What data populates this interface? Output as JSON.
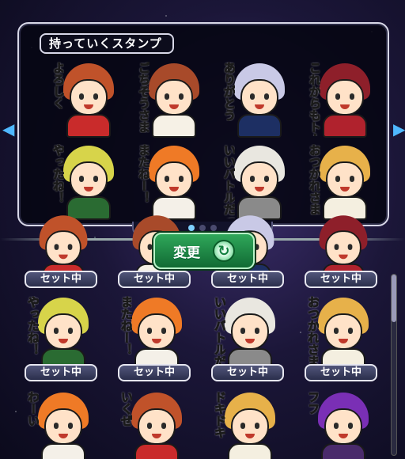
{
  "panel": {
    "title": "持っていくスタンプ",
    "page_count": 3,
    "current_page": 1
  },
  "change_button": {
    "label": "変更"
  },
  "set_label": "セット中",
  "stickers_carried": [
    {
      "text": "よろしく",
      "hair": "#c0522a",
      "outfit": "#c92b2b",
      "text_color": "#3fd35a"
    },
    {
      "text": "ごちそうさま",
      "hair": "#a84a2a",
      "outfit": "#f6f1e6",
      "text_color": "#ff6aa0"
    },
    {
      "text": "ありがとう",
      "hair": "#c9c9e6",
      "outfit": "#1d2f63",
      "text_color": "#ff6aa0"
    },
    {
      "text": "これからもトーゼンね",
      "hair": "#8e1f2a",
      "outfit": "#b0222d",
      "text_color": "#ffcf3a"
    },
    {
      "text": "やったね！",
      "hair": "#d7d44a",
      "outfit": "#2a6b32",
      "text_color": "#3fd35a"
    },
    {
      "text": "またねー！",
      "hair": "#ef7a26",
      "outfit": "#f4f0e8",
      "text_color": "#3fd35a"
    },
    {
      "text": "いいバトルだった！",
      "hair": "#e9e7e0",
      "outfit": "#8a8a8a",
      "text_color": "#ffcf3a"
    },
    {
      "text": "おつかれさま",
      "hair": "#e7b14a",
      "outfit": "#f4efe0",
      "text_color": "#ff6aa0"
    }
  ],
  "collection": [
    {
      "hair": "#c0522a",
      "outfit": "#c92b2b",
      "set": true
    },
    {
      "hair": "#a84a2a",
      "outfit": "#f6f1e6",
      "set": true
    },
    {
      "hair": "#c9c9e6",
      "outfit": "#1d2f63",
      "set": true
    },
    {
      "hair": "#8e1f2a",
      "outfit": "#b0222d",
      "set": true
    },
    {
      "text": "やったね！",
      "hair": "#d7d44a",
      "outfit": "#2a6b32",
      "text_color": "#3fd35a",
      "set": true
    },
    {
      "text": "またねー！",
      "hair": "#ef7a26",
      "outfit": "#f4f0e8",
      "text_color": "#3fd35a",
      "set": true
    },
    {
      "text": "いいバトルだった！",
      "hair": "#e9e7e0",
      "outfit": "#8a8a8a",
      "text_color": "#ffcf3a",
      "set": true
    },
    {
      "text": "おつかれさま",
      "hair": "#e7b14a",
      "outfit": "#f4efe0",
      "text_color": "#ff6aa0",
      "set": true
    },
    {
      "text": "わーい",
      "hair": "#ef7a26",
      "outfit": "#f4f0e8",
      "text_color": "#ff6aa0",
      "set": false
    },
    {
      "text": "いくぜ",
      "hair": "#c0522a",
      "outfit": "#c92b2b",
      "text_color": "#3fd35a",
      "set": false
    },
    {
      "text": "ドキドキ",
      "hair": "#e7b14a",
      "outfit": "#f4efe0",
      "text_color": "#ffcf3a",
      "set": false
    },
    {
      "text": "フフ",
      "hair": "#7a2fb5",
      "outfit": "#4a2b6b",
      "text_color": "#ff6aa0",
      "set": false
    }
  ],
  "colors": {
    "accent": "#4fb8ff",
    "button_green": "#2fa75a",
    "panel_border": "#d8d8e8"
  },
  "icons": {
    "prev": "chevron-left-icon",
    "next": "chevron-right-icon",
    "change": "refresh-icon"
  }
}
